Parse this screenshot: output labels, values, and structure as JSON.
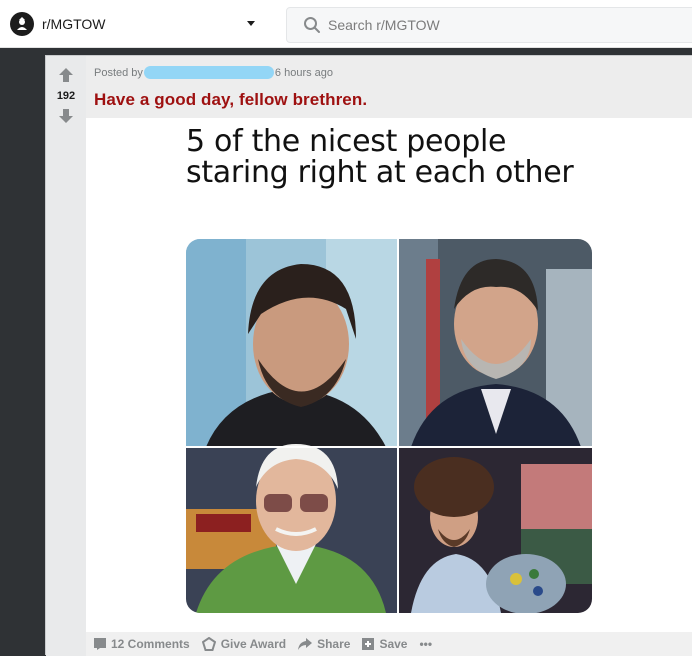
{
  "header": {
    "subreddit": "r/MGTOW",
    "search_placeholder": "Search r/MGTOW"
  },
  "post": {
    "score": "192",
    "posted_by_label": "Posted by",
    "time_ago": "6 hours ago",
    "title": "Have a good day, fellow brethren.",
    "image_caption_line1": "5 of the nicest people",
    "image_caption_line2": "staring right at each other",
    "collage_photos": [
      "man-with-dark-hair-and-beard",
      "man-with-grey-beard-in-suit",
      "elderly-man-with-tinted-glasses",
      "painter-with-afro-and-palette"
    ]
  },
  "footer": {
    "comments": "12 Comments",
    "award": "Give Award",
    "share": "Share",
    "save": "Save",
    "more": "•••"
  },
  "colors": {
    "title": "#9e1010",
    "redaction": "#93d6f6",
    "vote_column": "#e9eaeb"
  }
}
